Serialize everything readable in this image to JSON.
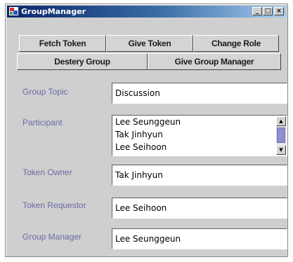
{
  "window": {
    "title": "GroupManager",
    "controls": {
      "minimize": "_",
      "maximize": "□",
      "close": "×"
    }
  },
  "toolbar": {
    "row1": [
      "Fetch Token",
      "Give Token",
      "Change Role"
    ],
    "row2": [
      "Destery Group",
      "Give Group Manager"
    ]
  },
  "form": {
    "group_topic": {
      "label": "Group Topic",
      "value": "Discussion"
    },
    "participant": {
      "label": "Participant",
      "items": [
        "Lee Seunggeun",
        "Tak Jinhyun",
        "Lee Seihoon"
      ]
    },
    "token_owner": {
      "label": "Token Owner",
      "value": "Tak Jinhyun"
    },
    "token_requestor": {
      "label": "Token Requestor",
      "value": "Lee Seihoon"
    },
    "group_manager": {
      "label": "Group Manager",
      "value": "Lee Seunggeun"
    }
  },
  "colors": {
    "label": "#6b6ba8",
    "window_bg": "#cfcfcf",
    "titlebar_start": "#0a246a",
    "titlebar_end": "#a6caf0"
  },
  "icons": {
    "app": "app-window-icon",
    "scroll_up": "scroll-up-arrow-icon",
    "scroll_down": "scroll-down-arrow-icon"
  }
}
